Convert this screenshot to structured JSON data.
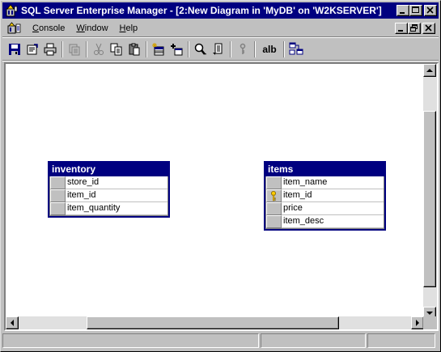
{
  "window": {
    "title": "SQL Server Enterprise Manager - [2:New Diagram in 'MyDB' on 'W2KSERVER']"
  },
  "menubar": {
    "items": [
      {
        "label": "Console",
        "key": "C"
      },
      {
        "label": "Window",
        "key": "W"
      },
      {
        "label": "Help",
        "key": "H"
      }
    ]
  },
  "toolbar": {
    "buttons": [
      "save-icon",
      "properties-icon",
      "print-icon",
      "copy-diagram-icon",
      "cut-icon",
      "copy-icon",
      "paste-icon",
      "new-table-icon",
      "add-table-icon",
      "zoom-icon",
      "layout-icon",
      "key-icon",
      "text-annotation-icon",
      "arrange-tables-icon"
    ],
    "text_button": "alb"
  },
  "diagram": {
    "tables": [
      {
        "name": "inventory",
        "columns": [
          {
            "name": "store_id",
            "key": false
          },
          {
            "name": "item_id",
            "key": false
          },
          {
            "name": "item_quantity",
            "key": false
          }
        ]
      },
      {
        "name": "items",
        "columns": [
          {
            "name": "item_name",
            "key": false
          },
          {
            "name": "item_id",
            "key": true
          },
          {
            "name": "price",
            "key": false
          },
          {
            "name": "item_desc",
            "key": false
          }
        ]
      }
    ]
  },
  "colors": {
    "title_bar": "#000080",
    "face": "#c0c0c0",
    "table_header": "#000080",
    "key": "#ffcc00"
  }
}
